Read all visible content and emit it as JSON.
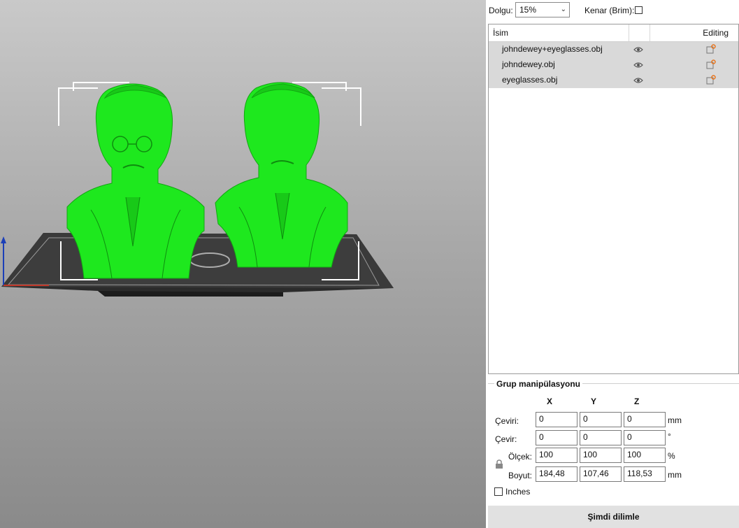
{
  "toolbar": {
    "infill_label": "Dolgu:",
    "infill_value": "15%",
    "brim_label": "Kenar (Brim):",
    "brim_checked": false
  },
  "object_list": {
    "col_name": "İsim",
    "col_editing": "Editing",
    "items": [
      {
        "name": "johndewey+eyeglasses.obj",
        "visible": true
      },
      {
        "name": "johndewey.obj",
        "visible": true
      },
      {
        "name": "eyeglasses.obj",
        "visible": true
      }
    ]
  },
  "manipulation": {
    "title": "Grup manipülasyonu",
    "axes": [
      "X",
      "Y",
      "Z"
    ],
    "rows": [
      {
        "label": "Çeviri:",
        "values": [
          "0",
          "0",
          "0"
        ],
        "unit": "mm"
      },
      {
        "label": "Çevir:",
        "values": [
          "0",
          "0",
          "0"
        ],
        "unit": "°"
      },
      {
        "label": "Ölçek:",
        "values": [
          "100",
          "100",
          "100"
        ],
        "unit": "%"
      },
      {
        "label": "Boyut:",
        "values": [
          "184,48",
          "107,46",
          "118,53"
        ],
        "unit": "mm"
      }
    ],
    "inches_label": "Inches",
    "inches_checked": false
  },
  "slice_button": "Şimdi dilimle",
  "colors": {
    "model": "#1ee81e",
    "bed": "#2b2b2b",
    "accent_icon": "#e8741c",
    "row_bg": "#d9d9d9"
  }
}
